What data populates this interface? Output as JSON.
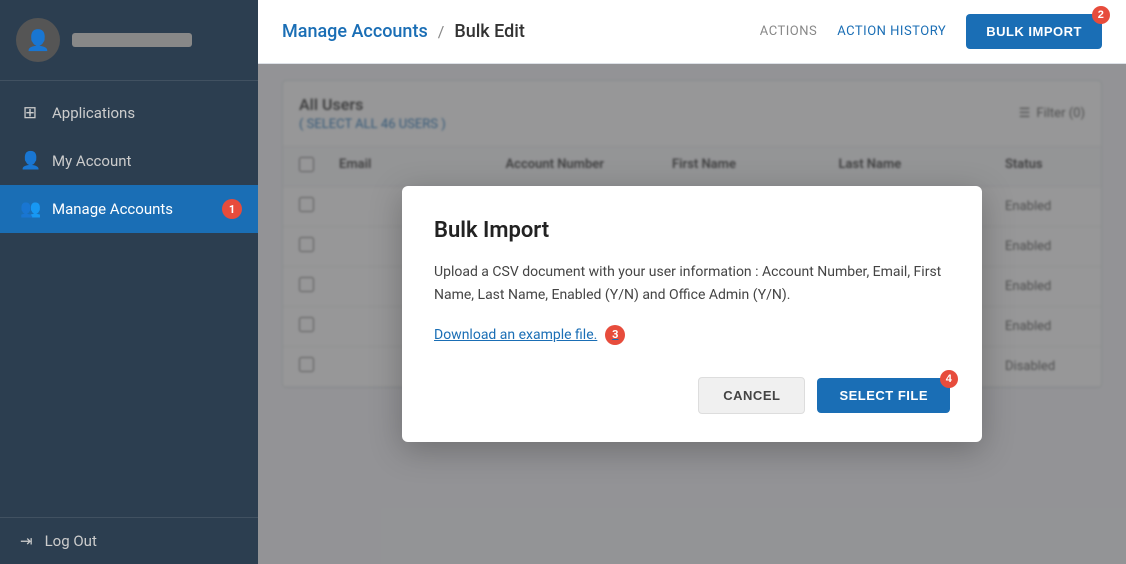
{
  "sidebar": {
    "avatar_icon": "👤",
    "items": [
      {
        "id": "applications",
        "label": "Applications",
        "icon": "⊞",
        "active": false,
        "badge": null
      },
      {
        "id": "my-account",
        "label": "My Account",
        "icon": "👤",
        "active": false,
        "badge": null
      },
      {
        "id": "manage-accounts",
        "label": "Manage Accounts",
        "icon": "👥",
        "active": true,
        "badge": "1"
      }
    ],
    "logout_label": "Log Out",
    "logout_icon": "→"
  },
  "header": {
    "breadcrumb_link": "Manage Accounts",
    "breadcrumb_sep": "/",
    "breadcrumb_current": "Bulk Edit",
    "actions_label": "ACTIONS",
    "action_history_label": "ACTION HISTORY",
    "bulk_import_label": "BULK IMPORT",
    "bulk_import_badge": "2"
  },
  "table": {
    "section_title": "All Users",
    "select_all_label": "( SELECT ALL 46 USERS )",
    "filter_label": "Filter (0)",
    "columns": [
      "Email",
      "Account Number",
      "First Name",
      "Last Name",
      "Status"
    ],
    "rows": [
      {
        "status": "Enabled"
      },
      {
        "status": "Enabled"
      },
      {
        "status": "Enabled"
      },
      {
        "status": "Enabled"
      },
      {
        "status": "Disabled"
      }
    ]
  },
  "modal": {
    "title": "Bulk Import",
    "body": "Upload a CSV document with your user information : Account Number, Email, First Name, Last Name, Enabled (Y/N) and Office Admin (Y/N).",
    "download_link": "Download an example file.",
    "download_badge": "3",
    "cancel_label": "CANCEL",
    "select_file_label": "SELECT FILE",
    "select_file_badge": "4"
  }
}
